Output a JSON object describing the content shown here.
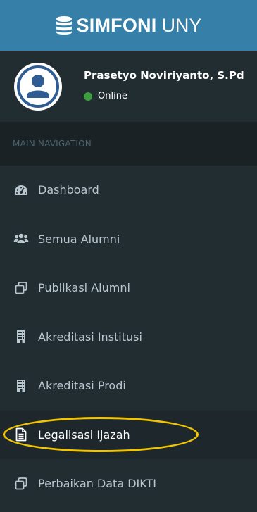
{
  "brand": {
    "bold": "SIMFONI",
    "light": "UNY"
  },
  "user": {
    "name": "Prasetyo Noviriyanto, S.Pd",
    "status": "Online",
    "status_color": "#3c9d3c"
  },
  "nav": {
    "section_title": "MAIN NAVIGATION",
    "items": [
      {
        "label": "Dashboard",
        "icon": "dashboard-icon"
      },
      {
        "label": "Semua Alumni",
        "icon": "users-icon"
      },
      {
        "label": "Publikasi Alumni",
        "icon": "clone-icon"
      },
      {
        "label": "Akreditasi Institusi",
        "icon": "building-icon"
      },
      {
        "label": "Akreditasi Prodi",
        "icon": "building-icon"
      },
      {
        "label": "Legalisasi Ijazah",
        "icon": "file-text-icon"
      },
      {
        "label": "Perbaikan Data DIKTI",
        "icon": "clone-icon"
      }
    ]
  },
  "colors": {
    "header_bg": "#367fa9",
    "sidebar_bg": "#222d32",
    "section_bg": "#1a2226",
    "active_bg": "#1e282c",
    "highlight": "#f2c500"
  }
}
